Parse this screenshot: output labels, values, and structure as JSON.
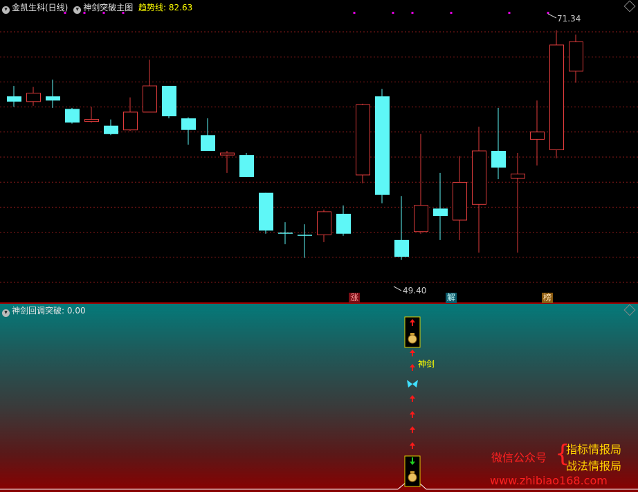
{
  "main_header": {
    "stock_name": "金凯生科(日线)",
    "indicator_name": "神剑突破主图",
    "trend_label": "趋势线:",
    "trend_value": "82.63"
  },
  "sub_header": {
    "indicator_name": "神剑回调突破",
    "value": ": 0.00"
  },
  "annotations": {
    "high_price": "71.34",
    "low_price": "49.40",
    "tag_zhang": "涨",
    "tag_jie": "解",
    "tag_bang": "榜",
    "shenjian_label": "神剑"
  },
  "watermark": {
    "line1": "微信公众号",
    "line2": "指标情报局",
    "line3": "战法情报局",
    "url": "www.zhibiao168.com"
  },
  "colors": {
    "up": "#e03c3c",
    "down": "#5ef7f7",
    "grid": "#8a1a1a",
    "magenta_dot": "#e000e0"
  },
  "chart_data": {
    "type": "candlestick",
    "y_range": [
      47,
      73
    ],
    "candles": [
      {
        "o": 65.0,
        "c": 64.5,
        "h": 66.0,
        "l": 64.0
      },
      {
        "o": 64.5,
        "c": 65.3,
        "h": 65.9,
        "l": 64.1
      },
      {
        "o": 65.0,
        "c": 64.6,
        "h": 66.6,
        "l": 63.9
      },
      {
        "o": 63.8,
        "c": 62.5,
        "h": 63.9,
        "l": 62.4
      },
      {
        "o": 62.6,
        "c": 62.8,
        "h": 64.0,
        "l": 62.5
      },
      {
        "o": 62.2,
        "c": 61.4,
        "h": 62.8,
        "l": 61.3
      },
      {
        "o": 61.8,
        "c": 63.5,
        "h": 64.9,
        "l": 61.7
      },
      {
        "o": 63.5,
        "c": 66.0,
        "h": 68.5,
        "l": 63.5
      },
      {
        "o": 66.0,
        "c": 63.1,
        "h": 66.0,
        "l": 62.9
      },
      {
        "o": 62.9,
        "c": 61.8,
        "h": 63.0,
        "l": 60.4
      },
      {
        "o": 61.3,
        "c": 59.8,
        "h": 62.9,
        "l": 59.8
      },
      {
        "o": 59.4,
        "c": 59.6,
        "h": 59.8,
        "l": 57.7
      },
      {
        "o": 59.4,
        "c": 57.3,
        "h": 59.6,
        "l": 57.3
      },
      {
        "o": 55.8,
        "c": 52.2,
        "h": 55.8,
        "l": 51.9
      },
      {
        "o": 52.0,
        "c": 51.9,
        "h": 53.0,
        "l": 50.9
      },
      {
        "o": 51.8,
        "c": 51.7,
        "h": 52.8,
        "l": 49.6
      },
      {
        "o": 51.8,
        "c": 54.0,
        "h": 54.2,
        "l": 51.1
      },
      {
        "o": 53.8,
        "c": 51.9,
        "h": 54.6,
        "l": 51.7
      },
      {
        "o": 57.5,
        "c": 64.2,
        "h": 64.3,
        "l": 56.7
      },
      {
        "o": 65.0,
        "c": 55.6,
        "h": 65.7,
        "l": 54.8
      },
      {
        "o": 51.3,
        "c": 49.7,
        "h": 55.5,
        "l": 49.4
      },
      {
        "o": 52.1,
        "c": 54.6,
        "h": 61.4,
        "l": 51.9
      },
      {
        "o": 54.3,
        "c": 53.6,
        "h": 57.7,
        "l": 51.3
      },
      {
        "o": 53.2,
        "c": 56.8,
        "h": 59.3,
        "l": 51.3
      },
      {
        "o": 54.7,
        "c": 59.8,
        "h": 62.1,
        "l": 50.1
      },
      {
        "o": 59.8,
        "c": 58.2,
        "h": 63.9,
        "l": 57.1
      },
      {
        "o": 57.2,
        "c": 57.6,
        "h": 59.6,
        "l": 50.1
      },
      {
        "o": 60.9,
        "c": 61.6,
        "h": 64.6,
        "l": 58.4
      },
      {
        "o": 59.9,
        "c": 69.9,
        "h": 71.3,
        "l": 59.1
      },
      {
        "o": 67.4,
        "c": 70.2,
        "h": 70.9,
        "l": 66.3
      }
    ]
  }
}
